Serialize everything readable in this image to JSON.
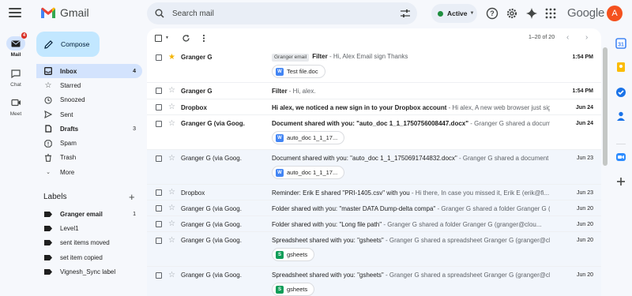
{
  "app": {
    "name": "Gmail"
  },
  "search": {
    "placeholder": "Search mail"
  },
  "status": {
    "label": "Active",
    "color": "#1e8e3e"
  },
  "header": {
    "brand": "Google",
    "avatar_initial": "A",
    "avatar_color": "#f4511e"
  },
  "rail": {
    "items": [
      {
        "label": "Mail",
        "badge": "4",
        "icon": "mail-icon"
      },
      {
        "label": "Chat",
        "icon": "chat-icon"
      },
      {
        "label": "Meet",
        "icon": "meet-icon"
      }
    ]
  },
  "compose": {
    "label": "Compose"
  },
  "nav": {
    "items": [
      {
        "label": "Inbox",
        "count": "4",
        "icon": "inbox-icon"
      },
      {
        "label": "Starred",
        "count": "",
        "icon": "star-icon"
      },
      {
        "label": "Snoozed",
        "count": "",
        "icon": "clock-icon"
      },
      {
        "label": "Sent",
        "count": "",
        "icon": "send-icon"
      },
      {
        "label": "Drafts",
        "count": "3",
        "icon": "draft-icon"
      },
      {
        "label": "Spam",
        "count": "",
        "icon": "spam-icon"
      },
      {
        "label": "Trash",
        "count": "",
        "icon": "trash-icon"
      },
      {
        "label": "More",
        "count": "",
        "icon": "chevron-down-icon"
      }
    ]
  },
  "labels": {
    "title": "Labels",
    "items": [
      {
        "label": "Granger email",
        "count": "1"
      },
      {
        "label": "Level1",
        "count": ""
      },
      {
        "label": "sent items moved",
        "count": ""
      },
      {
        "label": "set item copied",
        "count": ""
      },
      {
        "label": "Vignesh_Sync label",
        "count": ""
      }
    ]
  },
  "toolbar": {
    "pagination": "1–20 of 20"
  },
  "emails": [
    {
      "sender": "Granger G",
      "tag": "Granger email",
      "subject": "Filter",
      "snippet": " - Hi, Alex Email sign Thanks",
      "date": "1:54 PM",
      "unread": true,
      "starred": true,
      "attachment": "Test file.doc",
      "attachment_type": "W"
    },
    {
      "sender": "Granger G",
      "tag": "",
      "subject": "Filter",
      "snippet": " - Hi, alex.",
      "date": "1:54 PM",
      "unread": true,
      "starred": false,
      "attachment": "",
      "attachment_type": ""
    },
    {
      "sender": "Dropbox",
      "tag": "",
      "subject": "Hi alex, we noticed a new sign in to your Dropbox account",
      "snippet": " - Hi alex, A new web browser just signed in to your Dropbox account",
      "date": "Jun 24",
      "unread": true,
      "starred": false,
      "attachment": "",
      "attachment_type": ""
    },
    {
      "sender": "Granger G (via Goog.",
      "tag": "",
      "subject": "Document shared with you: \"auto_doc 1_1_1750756008447.docx\"",
      "snippet": " - Granger G shared a document",
      "date": "Jun 24",
      "unread": true,
      "starred": false,
      "attachment": "auto_doc 1_1_17...",
      "attachment_type": "W"
    },
    {
      "sender": "Granger G (via Goog.",
      "tag": "",
      "subject": "Document shared with you: \"auto_doc 1_1_1750691744832.docx\"",
      "snippet": " - Granger G shared a document",
      "date": "Jun 23",
      "unread": false,
      "starred": false,
      "attachment": "auto_doc 1_1_17...",
      "attachment_type": "W"
    },
    {
      "sender": "Dropbox",
      "tag": "",
      "subject": "Reminder: Erik E shared \"PRI-1405.csv\" with you",
      "snippet": " - Hi there, In case you missed it, Erik E (erik@fi...",
      "date": "Jun 23",
      "unread": false,
      "starred": false,
      "attachment": "",
      "attachment_type": ""
    },
    {
      "sender": "Granger G (via Goog.",
      "tag": "",
      "subject": "Folder shared with you: \"master DATA Dump-delta compa\"",
      "snippet": " - Granger G shared a folder Granger G (granger@cloud",
      "date": "Jun 20",
      "unread": false,
      "starred": false,
      "attachment": "",
      "attachment_type": ""
    },
    {
      "sender": "Granger G (via Goog.",
      "tag": "",
      "subject": "Folder shared with you: \"Long file path\"",
      "snippet": " - Granger G shared a folder Granger G (granger@clou...",
      "date": "Jun 20",
      "unread": false,
      "starred": false,
      "attachment": "",
      "attachment_type": ""
    },
    {
      "sender": "Granger G (via Goog.",
      "tag": "",
      "subject": "Spreadsheet shared with you: \"gsheets\"",
      "snippet": " - Granger G shared a spreadsheet Granger G (granger@cloud",
      "date": "Jun 20",
      "unread": false,
      "starred": false,
      "attachment": "gsheets",
      "attachment_type": "S"
    },
    {
      "sender": "Granger G (via Goog.",
      "tag": "",
      "subject": "Spreadsheet shared with you: \"gsheets\"",
      "snippet": " - Granger G shared a spreadsheet Granger G (granger@cloud",
      "date": "Jun 20",
      "unread": false,
      "starred": false,
      "attachment": "gsheets",
      "attachment_type": "S"
    }
  ]
}
